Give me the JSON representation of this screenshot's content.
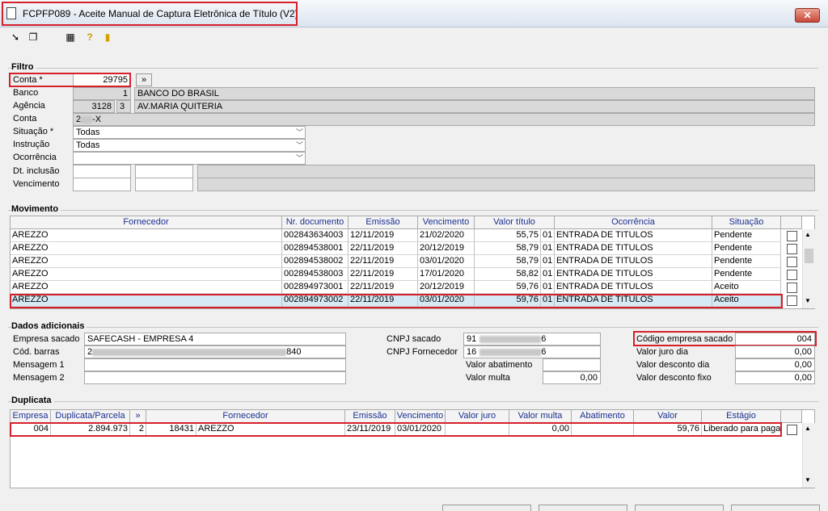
{
  "window": {
    "title": "FCPFP089 - Aceite Manual de Captura Eletrônica de Título (V2)",
    "close_label": "✕"
  },
  "toolbar": {
    "icons": [
      "arrow-icon",
      "copy-icon",
      "calculator-icon",
      "help-icon",
      "exit-icon"
    ]
  },
  "filtro": {
    "title": "Filtro",
    "conta_label": "Conta *",
    "conta_value": "29795",
    "conta_btn": "»",
    "banco_label": "Banco",
    "banco_code": "1",
    "banco_name": "BANCO DO BRASIL",
    "agencia_label": "Agência",
    "agencia_code": "3128",
    "agencia_dv": "3",
    "agencia_name": "AV.MARIA QUITERIA",
    "conta2_label": "Conta",
    "conta2_prefix": "2",
    "conta2_suffix": "-X",
    "situacao_label": "Situação *",
    "situacao_value": "Todas",
    "instrucao_label": "Instrução",
    "instrucao_value": "Todas",
    "ocorrencia_label": "Ocorrência",
    "ocorrencia_value": "",
    "dt_inclusao_label": "Dt. inclusão",
    "vencimento_label": "Vencimento"
  },
  "movimento": {
    "title": "Movimento",
    "columns": [
      "Fornecedor",
      "Nr. documento",
      "Emissão",
      "Vencimento",
      "Valor título",
      "Ocorrência",
      "Situação"
    ],
    "rows": [
      [
        "AREZZO",
        "002843634003",
        "12/11/2019",
        "21/02/2020",
        "55,75",
        "01",
        "ENTRADA DE TITULOS",
        "Pendente"
      ],
      [
        "AREZZO",
        "002894538001",
        "22/11/2019",
        "20/12/2019",
        "58,79",
        "01",
        "ENTRADA DE TITULOS",
        "Pendente"
      ],
      [
        "AREZZO",
        "002894538002",
        "22/11/2019",
        "03/01/2020",
        "58,79",
        "01",
        "ENTRADA DE TITULOS",
        "Pendente"
      ],
      [
        "AREZZO",
        "002894538003",
        "22/11/2019",
        "17/01/2020",
        "58,82",
        "01",
        "ENTRADA DE TITULOS",
        "Pendente"
      ],
      [
        "AREZZO",
        "002894973001",
        "22/11/2019",
        "20/12/2019",
        "59,76",
        "01",
        "ENTRADA DE TITULOS",
        "Aceito"
      ],
      [
        "AREZZO",
        "002894973002",
        "22/11/2019",
        "03/01/2020",
        "59,76",
        "01",
        "ENTRADA DE TITULOS",
        "Aceito"
      ]
    ]
  },
  "dados": {
    "title": "Dados adicionais",
    "empresa_sacado_label": "Empresa sacado",
    "empresa_sacado_value": "SAFECASH -  EMPRESA 4",
    "cod_barras_label": "Cód. barras",
    "cod_barras_prefix": "2",
    "cod_barras_suffix": "840",
    "mensagem1_label": "Mensagem 1",
    "mensagem2_label": "Mensagem 2",
    "cnpj_sacado_label": "CNPJ sacado",
    "cnpj_sacado_prefix": "91",
    "cnpj_sacado_suffix": "6",
    "cnpj_fornecedor_label": "CNPJ Fornecedor",
    "cnpj_fornecedor_prefix": "16",
    "cnpj_fornecedor_suffix": "6",
    "valor_abatimento_label": "Valor abatimento",
    "valor_multa_label": "Valor multa",
    "valor_multa_value": "0,00",
    "codigo_empresa_label": "Código empresa sacado",
    "codigo_empresa_value": "004",
    "valor_juro_dia_label": "Valor juro dia",
    "valor_juro_dia_value": "0,00",
    "valor_desconto_dia_label": "Valor desconto dia",
    "valor_desconto_dia_value": "0,00",
    "valor_desconto_fixo_label": "Valor desconto fixo",
    "valor_desconto_fixo_value": "0,00"
  },
  "duplicata": {
    "title": "Duplicata",
    "columns": [
      "Empresa",
      "Duplicata/Parcela",
      "»",
      "Fornecedor",
      "Emissão",
      "Vencimento",
      "Valor juro",
      "Valor multa",
      "Abatimento",
      "Valor",
      "Estágio"
    ],
    "row": [
      "004",
      "2.894.973",
      "2",
      "18431",
      "AREZZO",
      "23/11/2019",
      "03/01/2020",
      "",
      "0,00",
      "",
      "59,76",
      "Liberado para paga"
    ]
  }
}
